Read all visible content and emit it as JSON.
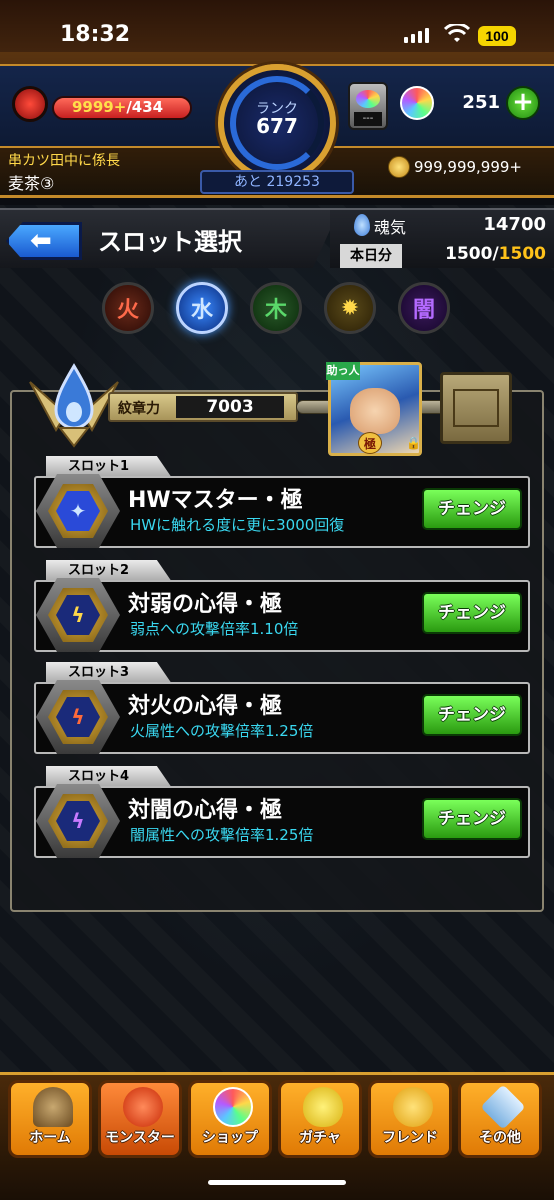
{
  "status_bar": {
    "time": "18:32",
    "battery": "100"
  },
  "header": {
    "stamina": {
      "current": "9999+",
      "max": "/434"
    },
    "rank": {
      "label": "ランク",
      "value": "677",
      "remaining": "あと 219253"
    },
    "gauge_slot": "---",
    "orbs": "251",
    "player_title": "串カツ田中に係長",
    "player_name": "麦茶③",
    "coins": "999,999,999+"
  },
  "title_bar": {
    "back_arrow": "⬅",
    "title": "スロット選択",
    "soul_label": "魂気",
    "soul_value": "14700",
    "daily_label": "本日分",
    "daily_used": "1500/",
    "daily_max": "1500"
  },
  "filters": [
    {
      "name": "fire",
      "icon": "fire-element-icon",
      "glyph": "火"
    },
    {
      "name": "water",
      "icon": "water-element-icon",
      "glyph": "水"
    },
    {
      "name": "wood",
      "icon": "wood-element-icon",
      "glyph": "木"
    },
    {
      "name": "light",
      "icon": "light-element-icon",
      "glyph": "✹"
    },
    {
      "name": "dark",
      "icon": "dark-element-icon",
      "glyph": "闇"
    }
  ],
  "emblem": {
    "power_label": "紋章力",
    "power_value": "7003"
  },
  "monster": {
    "tag": "助っ人",
    "ext_badge": "極"
  },
  "slots": [
    {
      "tag": "スロット1",
      "name": "HWマスター・極",
      "desc": "HWに触れる度に更に3000回復",
      "button": "チェンジ",
      "icon": "hw-master-icon",
      "glyph": "✦",
      "core_color": "#2a4ad8"
    },
    {
      "tag": "スロット2",
      "name": "対弱の心得・極",
      "desc": "弱点への攻撃倍率1.10倍",
      "button": "チェンジ",
      "icon": "anti-weak-icon",
      "glyph": "ϟ",
      "core_color": "#1a2a7a"
    },
    {
      "tag": "スロット3",
      "name": "対火の心得・極",
      "desc": "火属性への攻撃倍率1.25倍",
      "button": "チェンジ",
      "icon": "anti-fire-icon",
      "glyph": "ϟ",
      "core_color": "#1a2a7a"
    },
    {
      "tag": "スロット4",
      "name": "対闇の心得・極",
      "desc": "闇属性への攻撃倍率1.25倍",
      "button": "チェンジ",
      "icon": "anti-dark-icon",
      "glyph": "ϟ",
      "core_color": "#1a2a7a"
    }
  ],
  "bottom_nav": [
    {
      "label": "ホーム",
      "icon": "home-icon"
    },
    {
      "label": "モンスター",
      "icon": "monster-icon"
    },
    {
      "label": "ショップ",
      "icon": "shop-orb-icon"
    },
    {
      "label": "ガチャ",
      "icon": "gacha-egg-icon"
    },
    {
      "label": "フレンド",
      "icon": "friend-icon"
    },
    {
      "label": "その他",
      "icon": "other-icon"
    }
  ]
}
